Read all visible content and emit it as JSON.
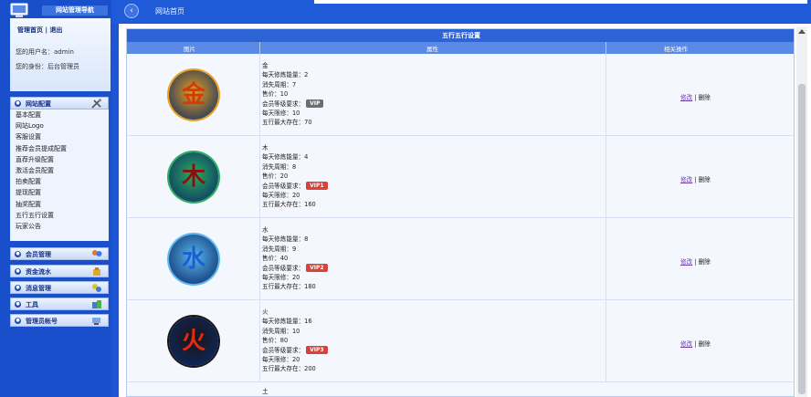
{
  "sidebar": {
    "brand_title": "网站管理导航",
    "user_links": {
      "home": "管理首页",
      "logout": "退出",
      "sep": "|"
    },
    "username_line": "您的用户名：admin",
    "role_line": "您的身份：后台管理员",
    "sections": [
      {
        "label": "网站配置",
        "icon": "tools-icon"
      },
      {
        "label": "会员管理",
        "icon": "users-icon"
      },
      {
        "label": "资金流水",
        "icon": "money-icon"
      },
      {
        "label": "消息管理",
        "icon": "message-icon"
      },
      {
        "label": "工具",
        "icon": "toolbox-icon"
      },
      {
        "label": "管理员帐号",
        "icon": "admin-icon"
      }
    ],
    "menu_items": [
      "基本配置",
      "网站Logo",
      "客服设置",
      "推荐会员提成配置",
      "直荐升级配置",
      "激活会员配置",
      "拍卖配置",
      "提现配置",
      "抽奖配置",
      "五行五行设置",
      "玩家公告"
    ]
  },
  "topbar": {
    "breadcrumb": "网站首页"
  },
  "panel": {
    "title": "五行五行设置",
    "columns": [
      "图片",
      "属性",
      "相关操作"
    ],
    "attr_labels": {
      "daily": "每天修炼能量：",
      "cycle": "消失周期：",
      "price": "售价：",
      "vip": "会员等级要求：",
      "limit": "每天限修：",
      "max": "五行最大存在："
    },
    "ops": {
      "edit": "修改",
      "sep": "|",
      "delete": "删除"
    },
    "rows": [
      {
        "name": "金",
        "glyph": "金",
        "daily": "2",
        "cycle": "7",
        "price": "10",
        "vip": "VIP",
        "limit": "10",
        "max": "70",
        "vip_color": "#6e6e6e",
        "bg": "#e8a11b",
        "fg": "#d63a0a"
      },
      {
        "name": "木",
        "glyph": "木",
        "daily": "4",
        "cycle": "8",
        "price": "20",
        "vip": "VIP1",
        "limit": "20",
        "max": "160",
        "vip_color": "#d9413b",
        "bg": "#2aae5a",
        "fg": "#8a1010"
      },
      {
        "name": "水",
        "glyph": "水",
        "daily": "8",
        "cycle": "9",
        "price": "40",
        "vip": "VIP2",
        "limit": "20",
        "max": "180",
        "vip_color": "#d9413b",
        "bg": "#58b8ee",
        "fg": "#1c5fd0"
      },
      {
        "name": "火",
        "glyph": "火",
        "daily": "16",
        "cycle": "10",
        "price": "80",
        "vip": "VIP3",
        "limit": "20",
        "max": "200",
        "vip_color": "#d9413b",
        "bg": "#1c1410",
        "fg": "#e02a18"
      }
    ],
    "next_row_name": "土"
  }
}
